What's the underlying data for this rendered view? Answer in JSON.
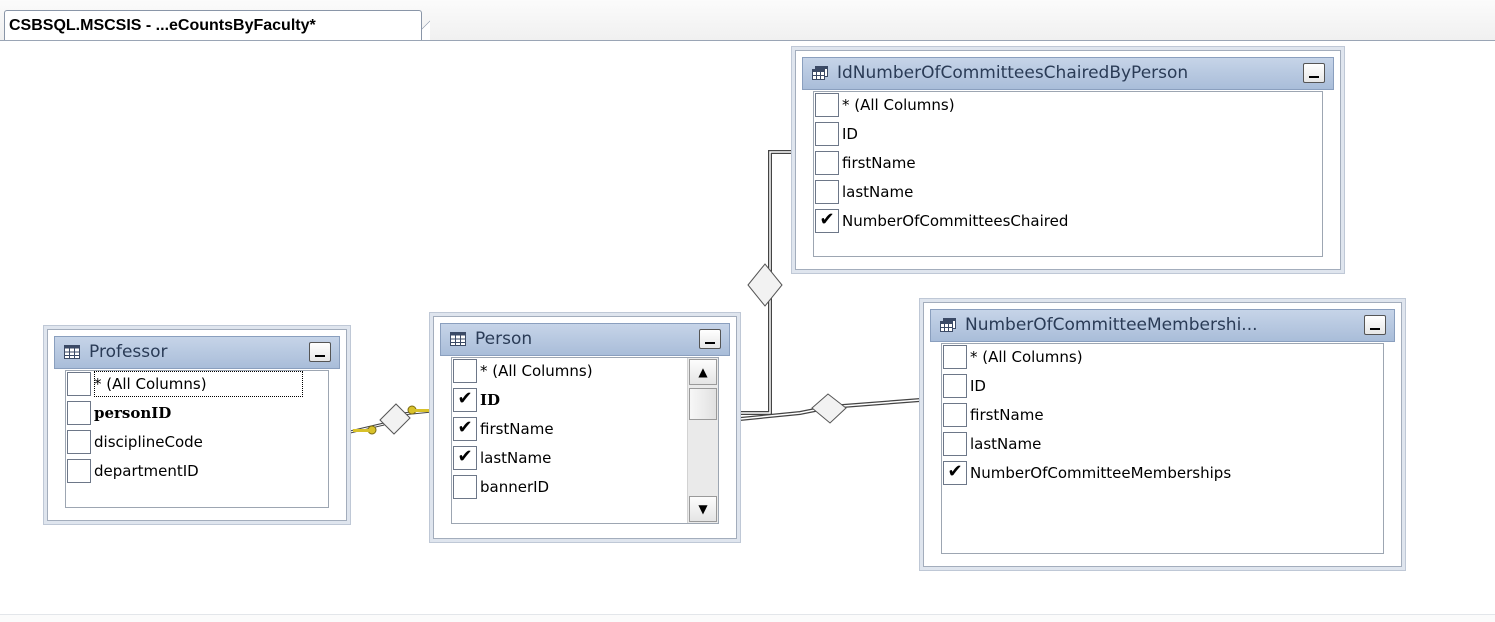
{
  "tab": {
    "title": "CSBSQL.MSCSIS - ...eCountsByFaculty*"
  },
  "boxes": {
    "professor": {
      "title": "Professor",
      "icon": "table-icon",
      "columns": [
        {
          "label": "* (All Columns)",
          "checked": false
        },
        {
          "label": "personID",
          "checked": false
        },
        {
          "label": "disciplineCode",
          "checked": false
        },
        {
          "label": "departmentID",
          "checked": false
        }
      ]
    },
    "person": {
      "title": "Person",
      "icon": "table-icon",
      "columns": [
        {
          "label": "* (All Columns)",
          "checked": false
        },
        {
          "label": "ID",
          "checked": true
        },
        {
          "label": "firstName",
          "checked": true
        },
        {
          "label": "lastName",
          "checked": true
        },
        {
          "label": "bannerID",
          "checked": false
        }
      ]
    },
    "chaired": {
      "title": "IdNumberOfCommitteesChairedByPerson",
      "icon": "view-icon",
      "columns": [
        {
          "label": "* (All Columns)",
          "checked": false
        },
        {
          "label": "ID",
          "checked": false
        },
        {
          "label": "firstName",
          "checked": false
        },
        {
          "label": "lastName",
          "checked": false
        },
        {
          "label": "NumberOfCommitteesChaired",
          "checked": true
        }
      ]
    },
    "memberships": {
      "title": "NumberOfCommitteeMembershi...",
      "icon": "view-icon",
      "columns": [
        {
          "label": "* (All Columns)",
          "checked": false
        },
        {
          "label": "ID",
          "checked": false
        },
        {
          "label": "firstName",
          "checked": false
        },
        {
          "label": "lastName",
          "checked": false
        },
        {
          "label": "NumberOfCommitteeMemberships",
          "checked": true
        }
      ]
    }
  },
  "check_glyph": "✔",
  "colors": {
    "header_gradient_top": "#c6d4e8",
    "header_gradient_bottom": "#a9bdd9",
    "title_text": "#2a3b56",
    "key_icon": "#d8c12a"
  }
}
